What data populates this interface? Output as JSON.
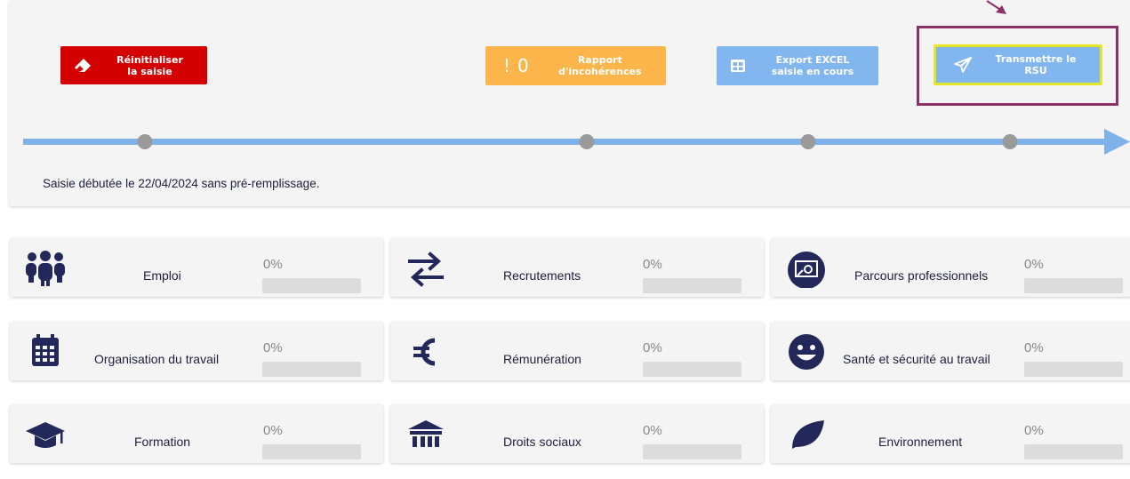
{
  "actions": {
    "reset": {
      "line1": "Réinitialiser",
      "line2": "la saisie",
      "icon": "eraser-icon"
    },
    "report": {
      "mark": "!",
      "count": "0",
      "line1": "Rapport",
      "line2": "d'incohérences",
      "icon": "exclamation-icon"
    },
    "excel": {
      "line1": "Export EXCEL",
      "line2": "saisie en cours",
      "icon": "table-icon"
    },
    "send": {
      "line1": "Transmettre le",
      "line2": "RSU",
      "icon": "paper-plane-icon"
    }
  },
  "status_text": "Saisie débutée le 22/04/2024 sans pré-remplissage.",
  "colors": {
    "reset": "#d40000",
    "report": "#fbb54a",
    "action_blue": "#82b6ee",
    "highlight": "#8c2f65",
    "icon_navy": "#23285a"
  },
  "cards": [
    {
      "label": "Emploi",
      "percent": "0%",
      "progress": 0,
      "icon": "people-icon"
    },
    {
      "label": "Recrutements",
      "percent": "0%",
      "progress": 0,
      "icon": "transfer-arrows-icon"
    },
    {
      "label": "Parcours professionnels",
      "percent": "0%",
      "progress": 0,
      "icon": "presentation-icon"
    },
    {
      "label": "Organisation du travail",
      "percent": "0%",
      "progress": 0,
      "icon": "calendar-icon"
    },
    {
      "label": "Rémunération",
      "percent": "0%",
      "progress": 0,
      "icon": "euro-icon"
    },
    {
      "label": "Santé et sécurité au travail",
      "percent": "0%",
      "progress": 0,
      "icon": "smiley-icon"
    },
    {
      "label": "Formation",
      "percent": "0%",
      "progress": 0,
      "icon": "graduation-cap-icon"
    },
    {
      "label": "Droits sociaux",
      "percent": "0%",
      "progress": 0,
      "icon": "institution-icon"
    },
    {
      "label": "Environnement",
      "percent": "0%",
      "progress": 0,
      "icon": "leaf-icon"
    }
  ]
}
